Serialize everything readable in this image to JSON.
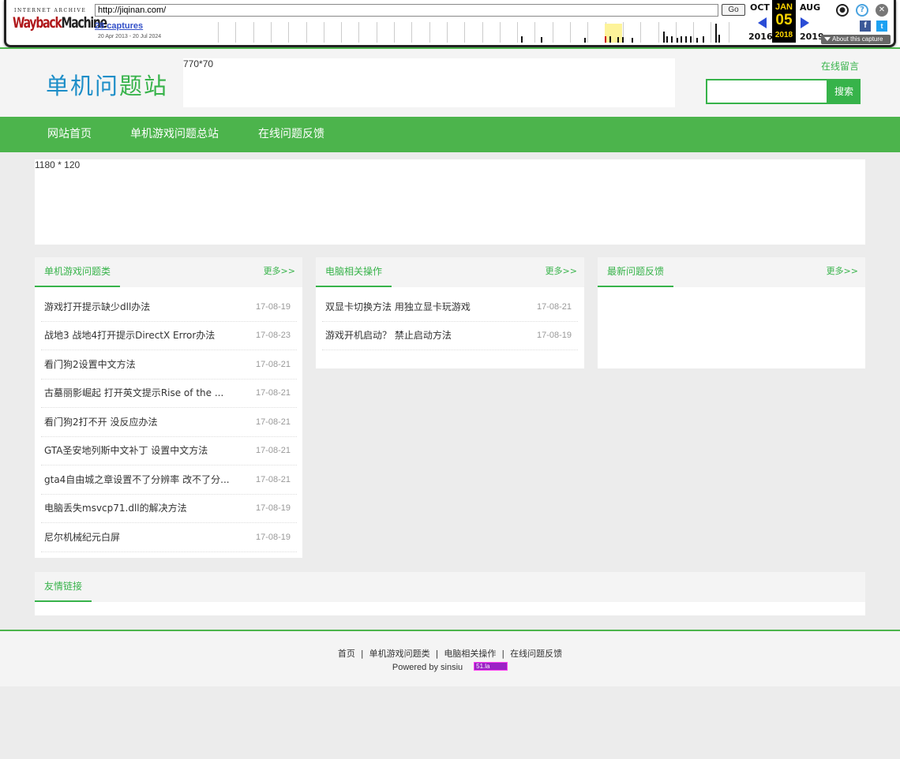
{
  "wayback": {
    "logo_top": "INTERNET ARCHIVE",
    "logo_main_1": "Wayback",
    "logo_main_2": "Machine",
    "url": "http://jiqinan.com/",
    "go_label": "Go",
    "captures": "28 captures",
    "range": "20 Apr 2013 - 20 Jul 2024",
    "prev_month": "OCT",
    "prev_year": "2016",
    "cur_month": "JAN",
    "cur_day": "05",
    "cur_year": "2018",
    "next_month": "AUG",
    "next_year": "2019",
    "about": "About this capture",
    "icons": [
      "user-icon",
      "help-icon",
      "close-icon",
      "facebook-icon",
      "twitter-icon",
      "prev-arrow-icon",
      "next-arrow-icon"
    ]
  },
  "header": {
    "logo_part1": "单机问",
    "logo_part2": "题站",
    "ad_label": "770*70",
    "feedback_link": "在线留言",
    "search_placeholder": "",
    "search_button": "搜索"
  },
  "nav": {
    "items": [
      "网站首页",
      "单机游戏问题总站",
      "在线问题反馈"
    ]
  },
  "banner": {
    "label": "1180 * 120"
  },
  "panels": [
    {
      "title": "单机游戏问题类",
      "more": "更多>>",
      "items": [
        {
          "title": "游戏打开提示缺少dll办法",
          "date": "17-08-19"
        },
        {
          "title": "战地3 战地4打开提示DirectX Error办法",
          "date": "17-08-23"
        },
        {
          "title": "看门狗2设置中文方法",
          "date": "17-08-21"
        },
        {
          "title": "古墓丽影崛起 打开英文提示Rise of the ...",
          "date": "17-08-21"
        },
        {
          "title": "看门狗2打不开 没反应办法",
          "date": "17-08-21"
        },
        {
          "title": "GTA圣安地列斯中文补丁 设置中文方法",
          "date": "17-08-21"
        },
        {
          "title": "gta4自由城之章设置不了分辨率 改不了分...",
          "date": "17-08-21"
        },
        {
          "title": "电脑丢失msvcp71.dll的解决方法",
          "date": "17-08-19"
        },
        {
          "title": "尼尔机械纪元白屏",
          "date": "17-08-19"
        }
      ]
    },
    {
      "title": "电脑相关操作",
      "more": "更多>>",
      "items": [
        {
          "title": "双显卡切换方法 用独立显卡玩游戏",
          "date": "17-08-21"
        },
        {
          "title": "游戏开机启动？ 禁止启动方法",
          "date": "17-08-19"
        }
      ]
    },
    {
      "title": "最新问题反馈",
      "more": "更多>>",
      "items": []
    }
  ],
  "friends": {
    "title": "友情链接"
  },
  "footer": {
    "links": [
      "首页",
      "单机游戏问题类",
      "电脑相关操作",
      "在线问题反馈"
    ],
    "separator": "|",
    "powered": "Powered by sinsiu",
    "badge": "51.la"
  },
  "colors": {
    "accent": "#4cb44c",
    "link_green": "#37b34a",
    "logo_blue": "#1d8ec8",
    "background": "#ececec"
  }
}
